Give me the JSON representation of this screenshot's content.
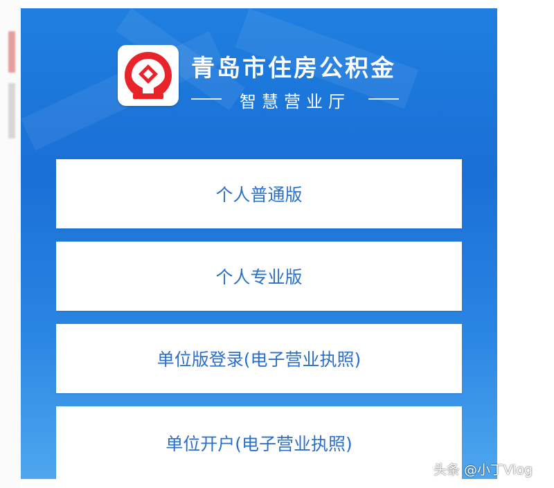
{
  "header": {
    "title": "青岛市住房公积金",
    "subtitle": "智慧营业厅"
  },
  "logo": {
    "icon": "housing-fund-logo-icon",
    "color": "#e8242a"
  },
  "menu": {
    "buttons": [
      {
        "label": "个人普通版"
      },
      {
        "label": "个人专业版"
      },
      {
        "label": "单位版登录(电子营业执照)"
      },
      {
        "label": "单位开户(电子营业执照)"
      }
    ]
  },
  "watermark": {
    "text": "头条 @小丁Vlog"
  },
  "colors": {
    "panel_blue": "#1f7fe0",
    "button_text": "#2a6fc9",
    "logo_red": "#e8242a"
  }
}
